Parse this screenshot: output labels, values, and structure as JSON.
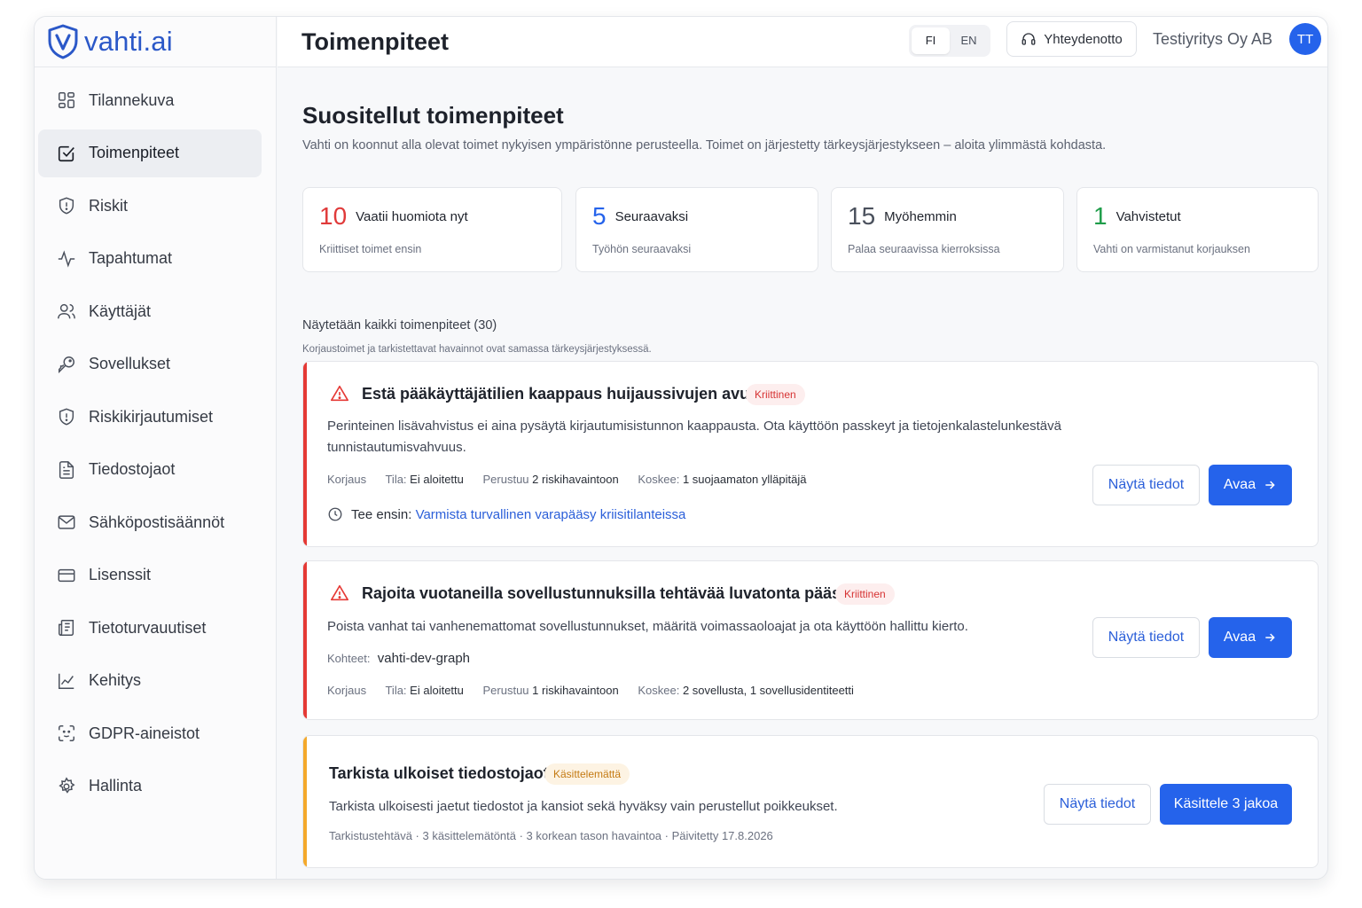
{
  "brand": {
    "name": "vahti.ai",
    "color": "#2b58c8"
  },
  "header": {
    "title": "Toimenpiteet",
    "lang": [
      "FI",
      "EN"
    ],
    "contact": "Yhteydenotto",
    "company": "Testiyritys Oy AB",
    "avatar": "TT"
  },
  "sidebar": {
    "items": [
      {
        "label": "Tilannekuva",
        "icon": "grid-icon"
      },
      {
        "label": "Toimenpiteet",
        "icon": "check-square-icon",
        "active": true
      },
      {
        "label": "Riskit",
        "icon": "shield-alert-icon"
      },
      {
        "label": "Tapahtumat",
        "icon": "activity-icon"
      },
      {
        "label": "Käyttäjät",
        "icon": "users-icon"
      },
      {
        "label": "Sovellukset",
        "icon": "key-icon"
      },
      {
        "label": "Riskikirjautumiset",
        "icon": "shield-alert-icon"
      },
      {
        "label": "Tiedostojaot",
        "icon": "file-icon"
      },
      {
        "label": "Sähköpostisäännöt",
        "icon": "mail-icon"
      },
      {
        "label": "Lisenssit",
        "icon": "credit-card-icon"
      },
      {
        "label": "Tietoturvauutiset",
        "icon": "newspaper-icon"
      },
      {
        "label": "Kehitys",
        "icon": "line-chart-icon"
      },
      {
        "label": "GDPR-aineistot",
        "icon": "scan-face-icon"
      },
      {
        "label": "Hallinta",
        "icon": "gear-icon"
      }
    ]
  },
  "main": {
    "heading": "Suositellut toimenpiteet",
    "intro": "Vahti on koonnut alla olevat toimet nykyisen ympäristönne perusteella. Toimet on järjestetty tärkeysjärjestykseen – aloita ylimmästä kohdasta.",
    "stats": [
      {
        "num": "10",
        "label": "Vaatii huomiota nyt",
        "sub": "Kriittiset toimet ensin",
        "color": "#e03a3a"
      },
      {
        "num": "5",
        "label": "Seuraavaksi",
        "sub": "Työhön seuraavaksi",
        "color": "#2563eb"
      },
      {
        "num": "15",
        "label": "Myöhemmin",
        "sub": "Palaa seuraavissa kierroksissa",
        "color": "#4a505c"
      },
      {
        "num": "1",
        "label": "Vahvistetut",
        "sub": "Vahti on varmistanut korjauksen",
        "color": "#1f9d4a"
      }
    ],
    "list_title": "Näytetään kaikki toimenpiteet (30)",
    "list_sub": "Korjaustoimet ja tarkistettavat havainnot ovat samassa tärkeysjärjestyksessä.",
    "cards": [
      {
        "title": "Estä pääkäyttäjätilien kaappaus huijaussivujen avulla",
        "badge": "Kriittinen",
        "desc": "Perinteinen lisävahvistus ei aina pysäytä kirjautumisistunnon kaappausta. Ota käyttöön passkeyt ja tietojenkalastelunkestävä tunnistautumisvahvuus.",
        "type": "Korjaus",
        "status_label": "Tila:",
        "status": "Ei aloitettu",
        "basis_label": "Perustuu",
        "basis": "2 riskihavaintoon",
        "affects_label": "Koskee:",
        "affects": "1 suojaamaton ylläpitäjä",
        "first_label": "Tee ensin:",
        "first_link": "Varmista turvallinen varapääsy kriisitilanteissa",
        "btn_details": "Näytä tiedot",
        "btn_open": "Avaa"
      },
      {
        "title": "Rajoita vuotaneilla sovellustunnuksilla tehtävää luvatonta pääsyä",
        "badge": "Kriittinen",
        "desc": "Poista vanhat tai vanhenemattomat sovellustunnukset, määritä voimassaoloajat ja ota käyttöön hallittu kierto.",
        "targets_label": "Kohteet:",
        "targets": "vahti-dev-graph",
        "type": "Korjaus",
        "status_label": "Tila:",
        "status": "Ei aloitettu",
        "basis_label": "Perustuu",
        "basis": "1 riskihavaintoon",
        "affects_label": "Koskee:",
        "affects": "2 sovellusta, 1 sovellusidentiteetti",
        "btn_details": "Näytä tiedot",
        "btn_open": "Avaa"
      },
      {
        "title": "Tarkista ulkoiset tiedostojaot",
        "badge": "Käsittelemättä",
        "desc": "Tarkista ulkoisesti jaetut tiedostot ja kansiot sekä hyväksy vain perustellut poikkeukset.",
        "meta": "Tarkistustehtävä · 3 käsittelemätöntä · 3 korkean tason havaintoa · Päivitetty 17.8.2026",
        "btn_details": "Näytä tiedot",
        "btn_action": "Käsittele 3 jakoa"
      }
    ]
  },
  "colors": {
    "primary": "#2563eb",
    "critical": "#e53935",
    "warning": "#f4a92b"
  }
}
